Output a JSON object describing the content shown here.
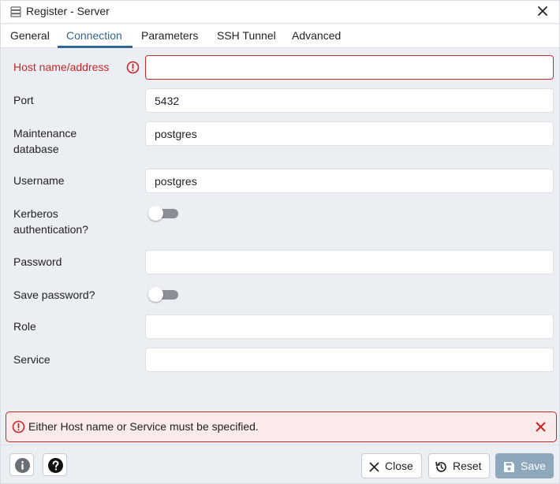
{
  "window": {
    "title": "Register - Server"
  },
  "tabs": [
    "General",
    "Connection",
    "Parameters",
    "SSH Tunnel",
    "Advanced"
  ],
  "active_tab": "Connection",
  "form": {
    "host": {
      "label": "Host name/address",
      "value": ""
    },
    "port": {
      "label": "Port",
      "value": "5432"
    },
    "maintenance_db": {
      "label_line1": "Maintenance",
      "label_line2": "database",
      "value": "postgres"
    },
    "username": {
      "label": "Username",
      "value": "postgres"
    },
    "kerberos": {
      "label_line1": "Kerberos",
      "label_line2": "authentication?",
      "enabled": false
    },
    "password": {
      "label": "Password",
      "value": ""
    },
    "save_password": {
      "label": "Save password?",
      "enabled": false
    },
    "role": {
      "label": "Role",
      "value": ""
    },
    "service": {
      "label": "Service",
      "value": ""
    }
  },
  "alert": {
    "message": "Either Host name or Service must be specified."
  },
  "footer": {
    "close_label": "Close",
    "reset_label": "Reset",
    "save_label": "Save"
  },
  "colors": {
    "accent": "#326690",
    "error": "#c62828",
    "save_disabled": "#8fa7bb",
    "background": "#ebeef3"
  }
}
